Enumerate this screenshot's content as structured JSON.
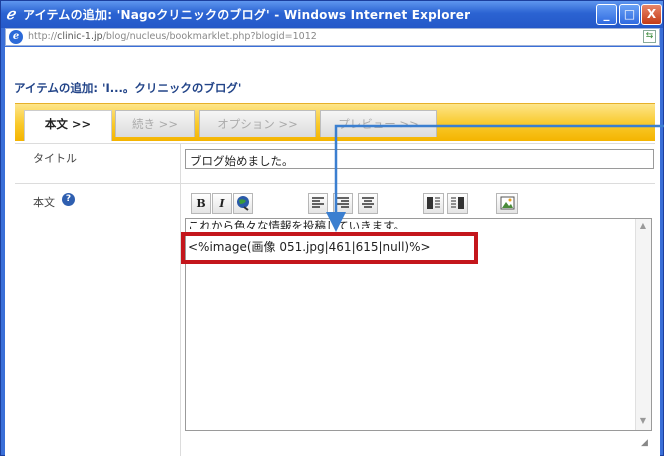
{
  "window": {
    "title": "アイテムの追加: 'Nagoクリニックのブログ' - Windows Internet Explorer",
    "controls": {
      "minimize": "_",
      "maximize": "□",
      "close": "X"
    }
  },
  "address_bar": {
    "url_prefix": "http://",
    "url_domain": "clinic-1.jp",
    "url_path": "/blog/nucleus/bookmarklet.php?blogid=1012"
  },
  "page": {
    "heading": "アイテムの追加: 'I...。クリニックのブログ'"
  },
  "tabs": [
    {
      "label": "本文 >>",
      "active": true
    },
    {
      "label": "続き >>",
      "active": false
    },
    {
      "label": "オプション >>",
      "active": false
    },
    {
      "label": "プレビュー >>",
      "active": false
    }
  ],
  "form": {
    "title_label": "タイトル",
    "title_value": "ブログ始めました。",
    "body_label": "本文",
    "help_icon": "?",
    "toolbar": {
      "bold": "B",
      "italic": "I",
      "link_icon": "globe-link-icon",
      "align_left_icon": "align-left-icon",
      "align_right_icon": "align-right-icon",
      "align_center_icon": "align-center-icon",
      "insert_media_icon": "insert-media-icon",
      "insert_media_right_icon": "insert-media-right-icon",
      "insert_image_icon": "insert-image-icon"
    },
    "body_text_line1": "これから色々な情報を投稿していきます。",
    "body_text_line2": "<%image(画像 051.jpg|461|615|null)%>"
  },
  "colors": {
    "highlight_border": "#c4161c",
    "annotation_arrow": "#3b7fd0",
    "tab_bar": "#f9c92a"
  }
}
